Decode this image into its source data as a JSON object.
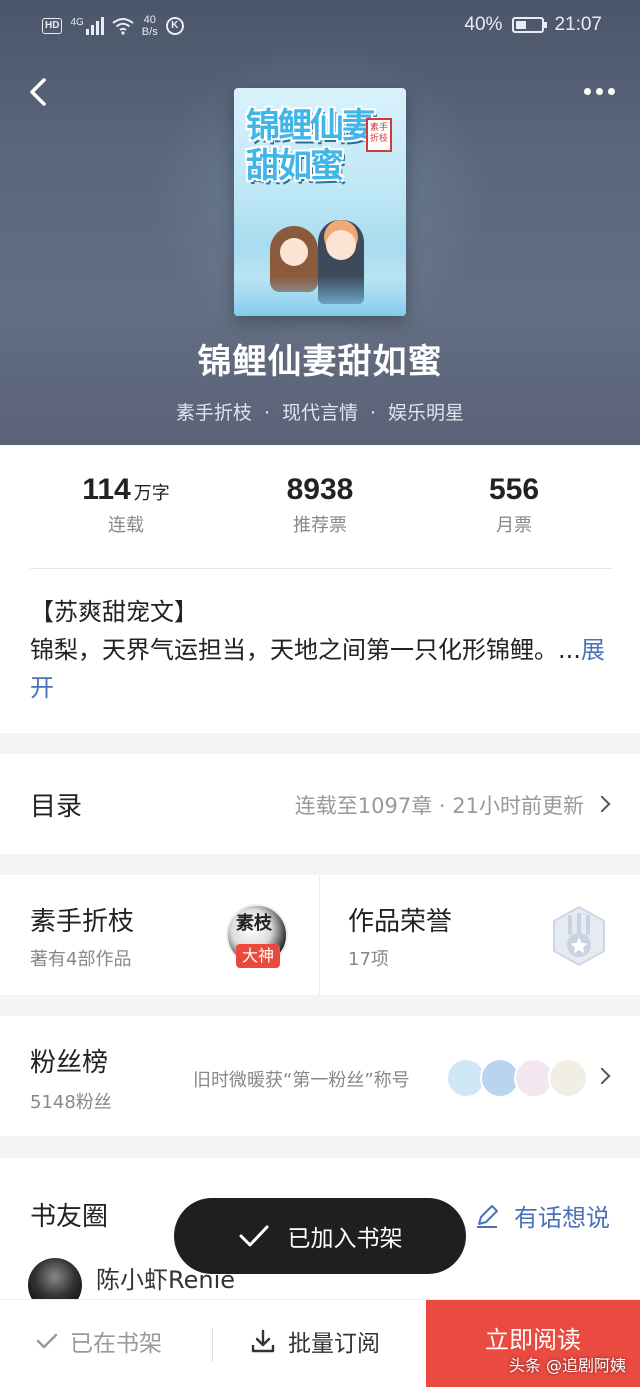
{
  "status_bar": {
    "hd": "HD",
    "network": "4G",
    "speed_value": "40",
    "speed_unit": "B/s",
    "k_badge": "K",
    "battery": "40%",
    "time": "21:07"
  },
  "book": {
    "cover_title": "锦鲤仙妻甜如蜜",
    "cover_stamp": "素手折枝",
    "title": "锦鲤仙妻甜如蜜",
    "author": "素手折枝",
    "category": "现代言情",
    "tag": "娱乐明星",
    "separator": "·"
  },
  "stats": [
    {
      "value": "114",
      "unit": "万字",
      "label": "连载"
    },
    {
      "value": "8938",
      "unit": "",
      "label": "推荐票"
    },
    {
      "value": "556",
      "unit": "",
      "label": "月票"
    }
  ],
  "intro": {
    "line1": "【苏爽甜宠文】",
    "line2": "锦梨，天界气运担当，天地之间第一只化形锦鲤。...",
    "expand": "展开"
  },
  "toc": {
    "title": "目录",
    "info": "连载至1097章 · 21小时前更新"
  },
  "author_card": {
    "name": "素手折枝",
    "works": "著有4部作品",
    "avatar_text": "素枝",
    "badge": "大神"
  },
  "honor_card": {
    "title": "作品荣誉",
    "count": "17项"
  },
  "fans": {
    "title": "粉丝榜",
    "count": "5148粉丝",
    "desc": "旧时微暖获“第一粉丝”称号",
    "avatar_colors": [
      "#cfe8f5",
      "#b8d4ee",
      "#f3e6ef",
      "#f1efe4"
    ]
  },
  "circle": {
    "title": "书友圈",
    "say": "有话想说",
    "first_user": "陈小虾Renie"
  },
  "toast": {
    "text": "已加入书架"
  },
  "bottom_bar": {
    "shelf": "已在书架",
    "batch": "批量订阅",
    "read": "立即阅读"
  },
  "watermark": "头条 @追剧阿姨",
  "colors": {
    "accent_blue": "#4a72b8",
    "read_red": "#ea4a40",
    "badge_red": "#e94a3d"
  }
}
